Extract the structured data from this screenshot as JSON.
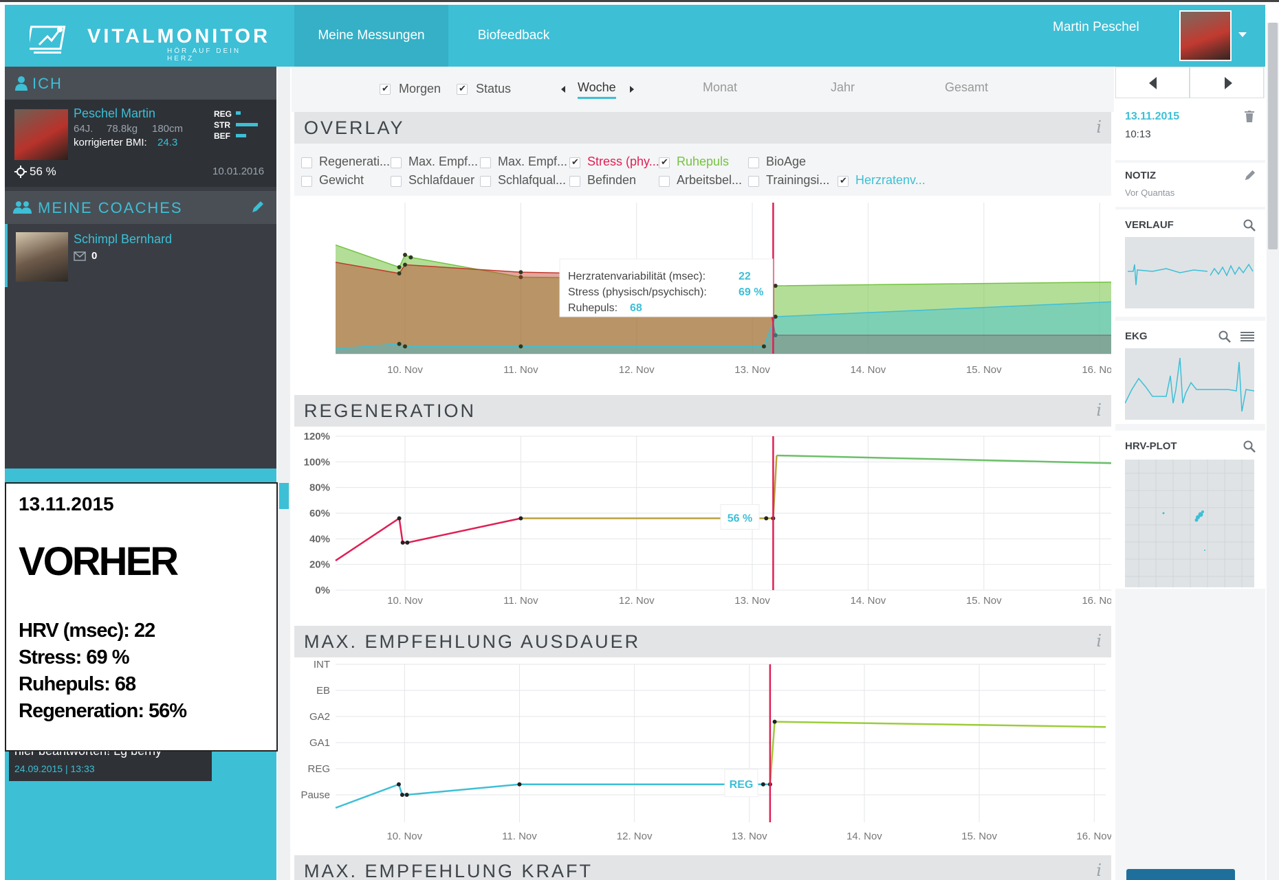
{
  "app": {
    "brand": "VITALMONITOR",
    "tagline": "HÖR AUF DEIN HERZ",
    "nav": [
      "Meine Messungen",
      "Biofeedback"
    ],
    "user": "Martin Peschel"
  },
  "colors": {
    "accent": "#3dbfd6",
    "red": "#e01f54",
    "green": "#74c342",
    "dark": "#3a3e44"
  },
  "sidebar": {
    "me_header": "ICH",
    "profile": {
      "name": "Peschel Martin",
      "age": "64J.",
      "weight": "78.8kg",
      "height": "180cm",
      "bmi_label": "korrigierter BMI:",
      "bmi_value": "24.3",
      "score": "56 %",
      "date": "10.01.2016",
      "bars": [
        {
          "label": "REG",
          "level": 0.1
        },
        {
          "label": "STR",
          "level": 1.0
        },
        {
          "label": "BEF",
          "level": 0.4
        }
      ]
    },
    "coaches_header": "MEINE COACHES",
    "coach": {
      "name": "Schimpl Bernhard",
      "messages": "0"
    },
    "message": {
      "text": "hier beantworten! Lg berny",
      "time": "24.09.2015 | 13:33"
    }
  },
  "note": {
    "date": "13.11.2015",
    "heading": "VORHER",
    "lines": [
      "HRV (msec): 22",
      "Stress: 69 %",
      "Ruhepuls: 68",
      "Regeneration: 56%"
    ]
  },
  "filters": {
    "checks": [
      {
        "label": "Morgen",
        "checked": true
      },
      {
        "label": "Status",
        "checked": true
      }
    ],
    "periods": [
      "Woche",
      "Monat",
      "Jahr",
      "Gesamt"
    ],
    "active_period": "Woche"
  },
  "overlay": {
    "title": "OVERLAY",
    "info": "i",
    "options": [
      {
        "label": "Regenerati...",
        "checked": false
      },
      {
        "label": "Max. Empf...",
        "checked": false
      },
      {
        "label": "Max. Empf...",
        "checked": false
      },
      {
        "label": "Stress (phy...",
        "checked": true,
        "color": "#e01f54"
      },
      {
        "label": "Ruhepuls",
        "checked": true,
        "color": "#74c342"
      },
      {
        "label": "BioAge",
        "checked": false
      },
      {
        "label": "Gewicht",
        "checked": false
      },
      {
        "label": "Schlafdauer",
        "checked": false
      },
      {
        "label": "Schlafqual...",
        "checked": false
      },
      {
        "label": "Befinden",
        "checked": false
      },
      {
        "label": "Arbeitsbel...",
        "checked": false
      },
      {
        "label": "Trainingsi...",
        "checked": false
      },
      {
        "label": "Herzratenv...",
        "checked": true,
        "color": "#3dbfd6"
      }
    ],
    "tooltip": [
      {
        "label": "Herzratenvariabilität (msec):",
        "value": "22"
      },
      {
        "label": "Stress (physisch/psychisch):",
        "value": "69 %"
      },
      {
        "label": "Ruhepuls:",
        "value": "68"
      }
    ]
  },
  "chart_data": [
    {
      "type": "area",
      "title": "OVERLAY",
      "x": [
        "10. Nov",
        "11. Nov",
        "12. Nov",
        "13. Nov",
        "14. Nov",
        "15. Nov",
        "16. Nov"
      ],
      "xrange": [
        9.6,
        16.3
      ],
      "series": [
        {
          "name": "Ruhepuls",
          "color": "#74c342",
          "points": [
            [
              9.6,
              88
            ],
            [
              10.15,
              70
            ],
            [
              10.2,
              80
            ],
            [
              10.25,
              78
            ],
            [
              11.2,
              62
            ],
            [
              13.3,
              60
            ],
            [
              13.4,
              55
            ],
            [
              16.3,
              58
            ]
          ]
        },
        {
          "name": "Stress (phy...",
          "color": "#c0392b",
          "points": [
            [
              9.6,
              74
            ],
            [
              10.15,
              65
            ],
            [
              10.2,
              72
            ],
            [
              11.2,
              66
            ],
            [
              13.3,
              62
            ],
            [
              13.4,
              15
            ],
            [
              16.3,
              15
            ]
          ]
        },
        {
          "name": "Herzratenv...",
          "color": "#3dbfd6",
          "points": [
            [
              9.6,
              4
            ],
            [
              10.15,
              8
            ],
            [
              10.2,
              6
            ],
            [
              11.2,
              6
            ],
            [
              13.3,
              6
            ],
            [
              13.4,
              30
            ],
            [
              16.3,
              42
            ]
          ]
        }
      ],
      "marker_x": 13.38
    },
    {
      "type": "line",
      "title": "REGENERATION",
      "x": [
        "10. Nov",
        "11. Nov",
        "12. Nov",
        "13. Nov",
        "14. Nov",
        "15. Nov",
        "16. Nov"
      ],
      "y_ticks": [
        "0%",
        "20%",
        "40%",
        "60%",
        "80%",
        "100%",
        "120%"
      ],
      "ylim": [
        0,
        120
      ],
      "xrange": [
        9.6,
        16.3
      ],
      "series": [
        {
          "name": "Regeneration",
          "points": [
            [
              9.6,
              23
            ],
            [
              10.15,
              56
            ],
            [
              10.18,
              37
            ],
            [
              10.22,
              37
            ],
            [
              11.2,
              56
            ],
            [
              13.32,
              56
            ],
            [
              13.38,
              56
            ],
            [
              13.41,
              105
            ],
            [
              16.3,
              99
            ]
          ]
        }
      ],
      "marker_x": 13.38,
      "label": "56 %"
    },
    {
      "type": "line",
      "title": "MAX. EMPFEHLUNG AUSDAUER",
      "x": [
        "10. Nov",
        "11. Nov",
        "12. Nov",
        "13. Nov",
        "14. Nov",
        "15. Nov",
        "16. Nov"
      ],
      "categories_y": [
        "Pause",
        "REG",
        "GA1",
        "GA2",
        "EB",
        "INT"
      ],
      "xrange": [
        9.6,
        16.3
      ],
      "series": [
        {
          "name": "Ausdauer",
          "points": [
            [
              9.6,
              -0.5
            ],
            [
              10.15,
              0.4
            ],
            [
              10.18,
              0
            ],
            [
              10.22,
              0
            ],
            [
              11.2,
              0.4
            ],
            [
              13.32,
              0.4
            ],
            [
              13.38,
              0.4
            ],
            [
              13.42,
              2.8
            ],
            [
              16.3,
              2.6
            ]
          ]
        }
      ],
      "marker_x": 13.38,
      "label": "REG"
    }
  ],
  "charts": {
    "regeneration_title": "REGENERATION",
    "ausdauer_title": "MAX. EMPFEHLUNG AUSDAUER",
    "kraft_title": "MAX. EMPFEHLUNG KRAFT"
  },
  "right": {
    "date": "13.11.2015",
    "time": "10:13",
    "notiz_title": "NOTIZ",
    "notiz_sub": "Vor Quantas",
    "verlauf_title": "VERLAUF",
    "ekg_title": "EKG",
    "hrv_title": "HRV-PLOT"
  }
}
